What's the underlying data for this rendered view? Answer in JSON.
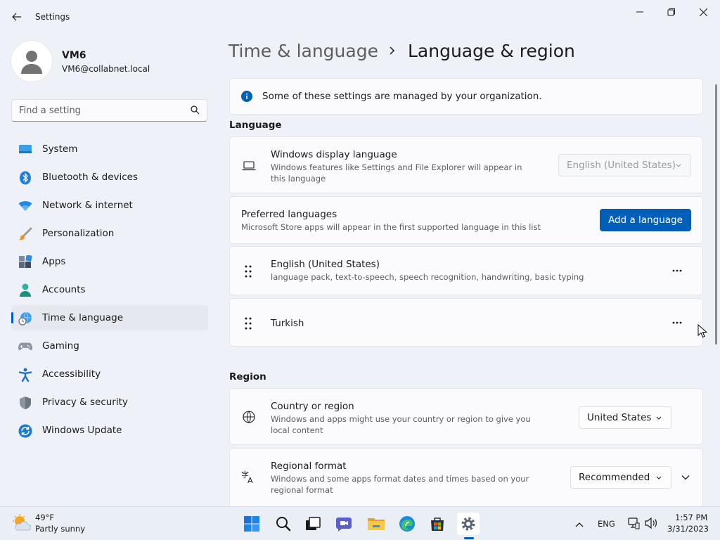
{
  "window": {
    "title": "Settings"
  },
  "user": {
    "name": "VM6",
    "email": "VM6@collabnet.local"
  },
  "search": {
    "placeholder": "Find a setting"
  },
  "nav": [
    {
      "label": "System",
      "icon": "monitor-icon"
    },
    {
      "label": "Bluetooth & devices",
      "icon": "bluetooth-icon"
    },
    {
      "label": "Network & internet",
      "icon": "wifi-icon"
    },
    {
      "label": "Personalization",
      "icon": "paintbrush-icon"
    },
    {
      "label": "Apps",
      "icon": "apps-icon"
    },
    {
      "label": "Accounts",
      "icon": "person-icon"
    },
    {
      "label": "Time & language",
      "icon": "globe-clock-icon",
      "selected": true
    },
    {
      "label": "Gaming",
      "icon": "gamepad-icon"
    },
    {
      "label": "Accessibility",
      "icon": "accessibility-icon"
    },
    {
      "label": "Privacy & security",
      "icon": "shield-icon"
    },
    {
      "label": "Windows Update",
      "icon": "update-icon"
    }
  ],
  "header": {
    "parent": "Time & language",
    "current": "Language & region"
  },
  "notice": {
    "text": "Some of these settings are managed by your organization."
  },
  "language": {
    "section_title": "Language",
    "display_language": {
      "title": "Windows display language",
      "desc": "Windows features like Settings and File Explorer will appear in this language",
      "value": "English (United States)"
    },
    "preferred": {
      "title": "Preferred languages",
      "desc": "Microsoft Store apps will appear in the first supported language in this list",
      "button": "Add a language"
    },
    "items": [
      {
        "name": "English (United States)",
        "desc": "language pack, text-to-speech, speech recognition, handwriting, basic typing"
      },
      {
        "name": "Turkish",
        "desc": ""
      }
    ]
  },
  "region": {
    "section_title": "Region",
    "country": {
      "title": "Country or region",
      "desc": "Windows and apps might use your country or region to give you local content",
      "value": "United States"
    },
    "format": {
      "title": "Regional format",
      "desc": "Windows and some apps format dates and times based on your regional format",
      "value": "Recommended"
    }
  },
  "taskbar": {
    "weather": {
      "temp": "49°F",
      "desc": "Partly sunny"
    },
    "input_language": "ENG",
    "time": "1:57 PM",
    "date": "3/31/2023"
  },
  "colors": {
    "accent": "#005fb8",
    "background": "#eef1f8",
    "card": "#fbfbfd"
  }
}
